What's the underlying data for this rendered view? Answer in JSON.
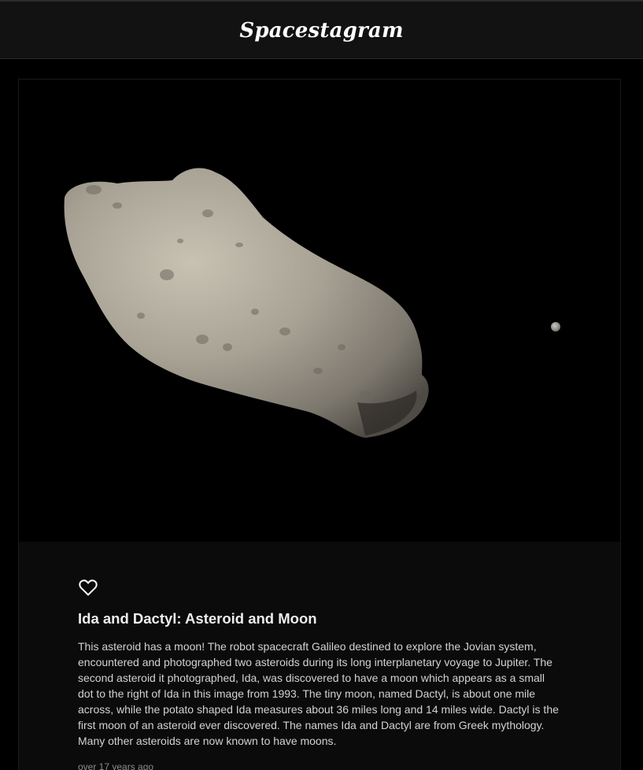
{
  "app": {
    "title": "Spacestagram"
  },
  "post": {
    "image_alt": "Ida and Dactyl: Asteroid and Moon",
    "like_icon": "heart-outline-icon",
    "title": "Ida and Dactyl: Asteroid and Moon",
    "description": "This asteroid has a moon! The robot spacecraft Galileo destined to explore the Jovian system, encountered and photographed two asteroids during its long interplanetary voyage to Jupiter. The second asteroid it photographed, Ida, was discovered to have a moon which appears as a small dot to the right of Ida in this image from 1993. The tiny moon, named Dactyl, is about one mile across, while the potato shaped Ida measures about 36 miles long and 14 miles wide. Dactyl is the first moon of an asteroid ever discovered. The names Ida and Dactyl are from Greek mythology. Many other asteroids are now known to have moons.",
    "date": "over 17 years ago"
  },
  "colors": {
    "page_background": "#000000",
    "header_background": "#121212",
    "card_background": "#0b0b0b",
    "title_text": "#ededed",
    "body_text": "#d2d2d2",
    "muted_text": "#8a8a8a"
  }
}
